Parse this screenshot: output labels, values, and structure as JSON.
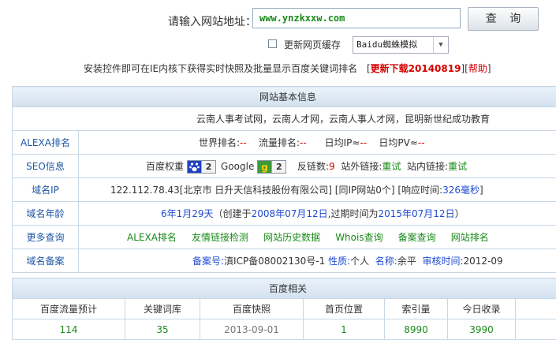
{
  "search": {
    "label": "请输入网站地址：",
    "url_value": "www.ynzkxxw.com",
    "query_button": "查 询",
    "cache_label": "更新网页缓存",
    "spider_selected": "Baidu蜘蛛模拟"
  },
  "notice": {
    "text": "安装控件即可在IE内核下获得实时快照及批量显示百度关键词排名",
    "bracket_open": "[",
    "download": "更新下载20140819",
    "mid": "][",
    "help": "帮助",
    "bracket_close": "]"
  },
  "basic": {
    "title": "网站基本信息",
    "site_title": "云南人事考试网，云南人才网，云南人事人才网，昆明新世纪成功教育",
    "alexa": {
      "key": "ALEXA排名",
      "world_label": "世界排名:",
      "world_value": "--",
      "flow_label": "流量排名:",
      "flow_value": "--",
      "ip_label": "日均IP≈",
      "ip_value": "--",
      "pv_label": "日均PV≈",
      "pv_value": "--"
    },
    "seo": {
      "key": "SEO信息",
      "baidu_label": "百度权重",
      "baidu_value": "2",
      "google_label": "Google",
      "google_value": "2",
      "backlinks_label": "反链数:",
      "backlinks_value": "9",
      "outlinks_label": "站外链接:",
      "outlinks_value": "重试",
      "inlinks_label": "站内链接:",
      "inlinks_value": "重试"
    },
    "ip": {
      "key": "域名IP",
      "text": "122.112.78.43[北京市 日升天信科技股份有限公司] [同IP网站0个] [响应时间:",
      "response": "326毫秒",
      "close": "]"
    },
    "age": {
      "key": "域名年龄",
      "age_value": "6年1月29天",
      "created_label": "（创建于",
      "created_value": "2008年07月12日",
      "expire_label": ",过期时间为",
      "expire_value": "2015年07月12日",
      "close": "）"
    },
    "more": {
      "key": "更多查询",
      "links": [
        "ALEXA排名",
        "友情链接检测",
        "网站历史数据",
        "Whois查询",
        "备案查询",
        "网站排名"
      ]
    },
    "beian": {
      "key": "域名备案",
      "no_label": "备案号:",
      "no_value": "滇ICP备08002130号-1",
      "nature_label": "性质:",
      "nature_value": "个人",
      "name_label": "名称:",
      "name_value": "余平",
      "audit_label": "审核时间:",
      "audit_value": "2012-09"
    }
  },
  "baidu": {
    "title": "百度相关",
    "headers": [
      "百度流量预计",
      "关键词库",
      "百度快照",
      "首页位置",
      "索引量",
      "今日收录"
    ],
    "values": [
      "114",
      "35",
      "2013-09-01",
      "1",
      "8990",
      "3990"
    ]
  },
  "colors": {
    "green": "#1a8a1a",
    "red": "#d40000",
    "blue": "#1e4ad0",
    "key_blue": "#1f57a6"
  }
}
